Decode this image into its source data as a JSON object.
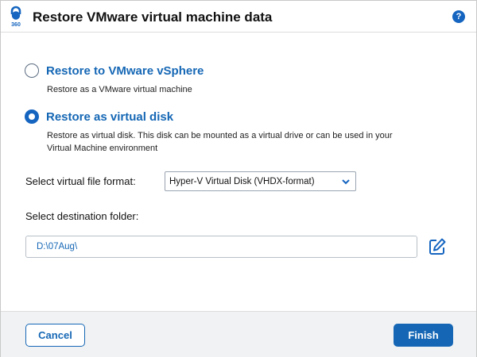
{
  "dialog": {
    "title": "Restore VMware virtual machine data",
    "help_label": "?",
    "logo_text": "360"
  },
  "options": [
    {
      "label": "Restore to VMware vSphere",
      "description": "Restore as a VMware virtual machine",
      "selected": false
    },
    {
      "label": "Restore as virtual disk",
      "description_line1": "Restore as virtual disk. This disk can be mounted as a virtual drive or can be used in your",
      "description_line2": "Virtual Machine environment",
      "selected": true
    }
  ],
  "format": {
    "label": "Select virtual file format:",
    "selected": "Hyper-V Virtual Disk (VHDX-format)"
  },
  "destination": {
    "label": "Select destination folder:",
    "value": "D:\\07Aug\\"
  },
  "footer": {
    "cancel_label": "Cancel",
    "finish_label": "Finish"
  },
  "colors": {
    "accent": "#1567b5",
    "footer_bg": "#f1f2f4"
  },
  "icons": {
    "logo": "lock-360-icon",
    "help": "help-icon",
    "dropdown": "chevron-down-icon",
    "edit": "edit-icon"
  }
}
